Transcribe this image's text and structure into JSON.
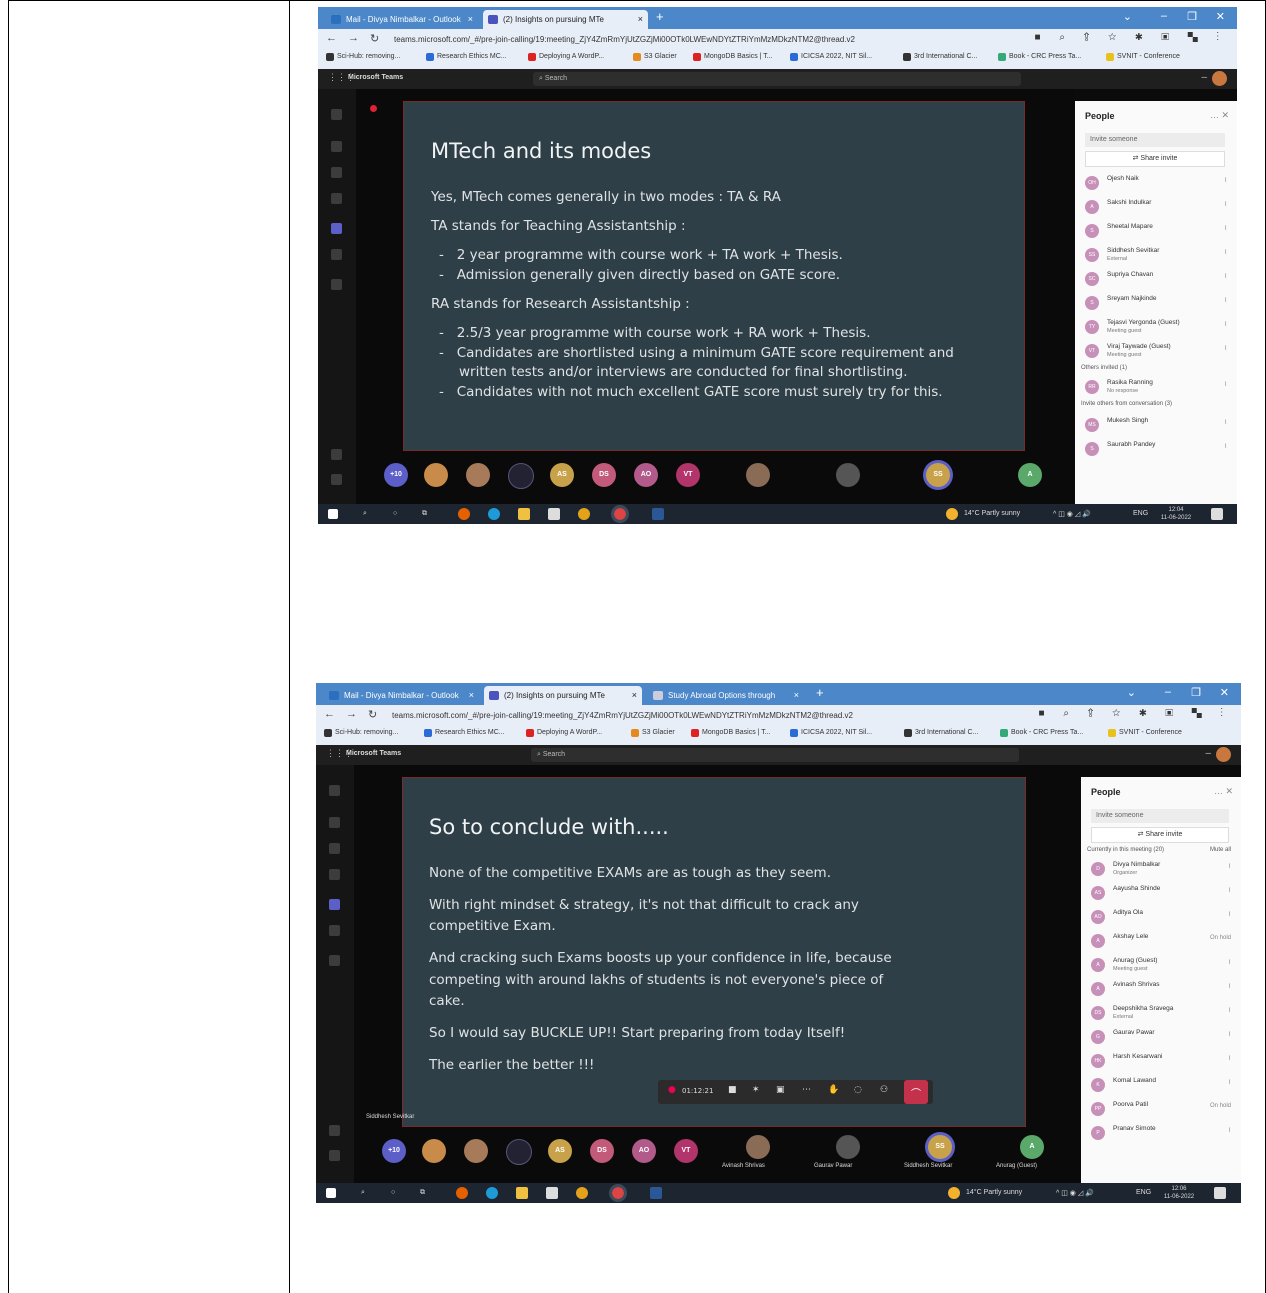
{
  "screenshot1": {
    "tabs": [
      {
        "label": "Mail - Divya Nimbalkar - Outlook",
        "color": "#2b6fbf"
      },
      {
        "label": "(2) Insights on pursuing MTe",
        "color": "#4b53bc"
      }
    ],
    "url": "teams.microsoft.com/_#/pre-join-calling/19:meeting_ZjY4ZmRmYjUtZGZjMi00OTk0LWEwNDYtZTRiYmMzMDkzNTM2@thread.v2",
    "bookmarks": [
      "Sci-Hub: removing...",
      "Research Ethics MC...",
      "Deploying A WordP...",
      "S3 Glacier",
      "MongoDB Basics | T...",
      "ICICSA 2022, NIT Sil...",
      "3rd International C...",
      "Book - CRC Press Ta...",
      "SVNIT - Conference"
    ],
    "app_title": "Microsoft Teams",
    "search_placeholder": "Search",
    "slide": {
      "title": "MTech and its modes",
      "lines": [
        "Yes, MTech comes generally in two modes : TA & RA",
        "TA stands for Teaching Assistantship :",
        "2 year programme with course work + TA work + Thesis.",
        "Admission generally given directly based on GATE score.",
        "RA stands for Research Assistantship :",
        "2.5/3 year programme with course work + RA work + Thesis.",
        "Candidates are shortlisted using a minimum GATE score requirement and",
        "written tests and/or interviews  are conducted for final shortlisting.",
        "Candidates with not much excellent GATE score must surely try for this."
      ]
    },
    "participants_strip": [
      "+10",
      "AS",
      "DS",
      "AO",
      "VT",
      "SS",
      "A"
    ],
    "people": {
      "title": "People",
      "invite_placeholder": "Invite someone",
      "share_label": "Share invite",
      "rows": [
        {
          "initials": "OH",
          "name": "Ojesh Naik",
          "sub": ""
        },
        {
          "initials": "A",
          "name": "Sakshi Indulkar",
          "sub": ""
        },
        {
          "initials": "S",
          "name": "Sheetal Mapare",
          "sub": ""
        },
        {
          "initials": "SS",
          "name": "Siddhesh Sevitkar",
          "sub": "External"
        },
        {
          "initials": "SC",
          "name": "Supriya Chavan",
          "sub": ""
        },
        {
          "initials": "S",
          "name": "Sreyam Najkinde",
          "sub": ""
        },
        {
          "initials": "TY",
          "name": "Tejasvi Yergonda (Guest)",
          "sub": "Meeting guest"
        },
        {
          "initials": "VT",
          "name": "Viraj Taywade (Guest)",
          "sub": "Meeting guest"
        }
      ],
      "others_invited": "Others invited (1)",
      "invited_rows": [
        {
          "initials": "RR",
          "name": "Rasika Ranning",
          "sub": "No response"
        }
      ],
      "invite_others": "Invite others from conversation (3)",
      "convo_rows": [
        {
          "initials": "MS",
          "name": "Mukesh Singh",
          "sub": ""
        },
        {
          "initials": "S",
          "name": "Saurabh Pandey",
          "sub": ""
        }
      ]
    },
    "taskbar": {
      "weather": "14°C  Partly sunny",
      "lang": "ENG",
      "time": "12:04",
      "date": "11-06-2022"
    }
  },
  "screenshot2": {
    "tabs": [
      {
        "label": "Mail - Divya Nimbalkar - Outlook",
        "color": "#2b6fbf"
      },
      {
        "label": "(2) Insights on pursuing MTe",
        "color": "#4b53bc"
      },
      {
        "label": "Study Abroad Options through",
        "color": "#9aa"
      }
    ],
    "url": "teams.microsoft.com/_#/pre-join-calling/19:meeting_ZjY4ZmRmYjUtZGZjMi00OTk0LWEwNDYtZTRiYmMzMDkzNTM2@thread.v2",
    "bookmarks": [
      "Sci-Hub: removing...",
      "Research Ethics MC...",
      "Deploying A WordP...",
      "S3 Glacier",
      "MongoDB Basics | T...",
      "ICICSA 2022, NIT Sil...",
      "3rd International C...",
      "Book - CRC Press Ta...",
      "SVNIT - Conference"
    ],
    "app_title": "Microsoft Teams",
    "search_placeholder": "Search",
    "slide": {
      "title": "So to conclude with.....",
      "lines": [
        "None of the competitive EXAMs are as tough as they seem.",
        "With right mindset & strategy, it's not that difficult to crack any",
        "competitive Exam.",
        "And cracking such Exams boosts up your confidence in life, because",
        "competing with around lakhs of students is not everyone's piece of",
        "cake.",
        "So I would say BUCKLE UP!! Start preparing from today Itself!",
        "The earlier the better !!!"
      ]
    },
    "meeting_timer": "01:12:21",
    "presenter_caption": "Siddhesh Sevitkar",
    "participants_strip": [
      "+10",
      "AS",
      "DS",
      "AO",
      "VT",
      "SS",
      "A"
    ],
    "strip_names": [
      "Avinash Shrivas",
      "Gaurav Pawar",
      "Siddhesh Sevitkar",
      "Anurag (Guest)"
    ],
    "people": {
      "title": "People",
      "invite_placeholder": "Invite someone",
      "share_label": "Share invite",
      "section": "Currently in this meeting (20)",
      "mute_all": "Mute all",
      "rows": [
        {
          "initials": "D",
          "name": "Divya Nimbalkar",
          "sub": "Organizer",
          "status": ""
        },
        {
          "initials": "AS",
          "name": "Aayusha Shinde",
          "sub": "",
          "status": ""
        },
        {
          "initials": "AO",
          "name": "Aditya Ola",
          "sub": "",
          "status": ""
        },
        {
          "initials": "A",
          "name": "Akshay Lele",
          "sub": "",
          "status": "On hold"
        },
        {
          "initials": "A",
          "name": "Anurag (Guest)",
          "sub": "Meeting guest",
          "status": ""
        },
        {
          "initials": "A",
          "name": "Avinash Shrivas",
          "sub": "",
          "status": ""
        },
        {
          "initials": "DS",
          "name": "Deepshikha Sravega",
          "sub": "External",
          "status": ""
        },
        {
          "initials": "G",
          "name": "Gaurav Pawar",
          "sub": "",
          "status": ""
        },
        {
          "initials": "HK",
          "name": "Harsh Kesarwani",
          "sub": "",
          "status": ""
        },
        {
          "initials": "K",
          "name": "Komal Lawand",
          "sub": "",
          "status": ""
        },
        {
          "initials": "PP",
          "name": "Poorva Patil",
          "sub": "",
          "status": "On hold"
        },
        {
          "initials": "P",
          "name": "Pranav Simote",
          "sub": "",
          "status": ""
        }
      ]
    },
    "taskbar": {
      "weather": "14°C  Partly sunny",
      "lang": "ENG",
      "time": "12:06",
      "date": "11-06-2022"
    }
  }
}
